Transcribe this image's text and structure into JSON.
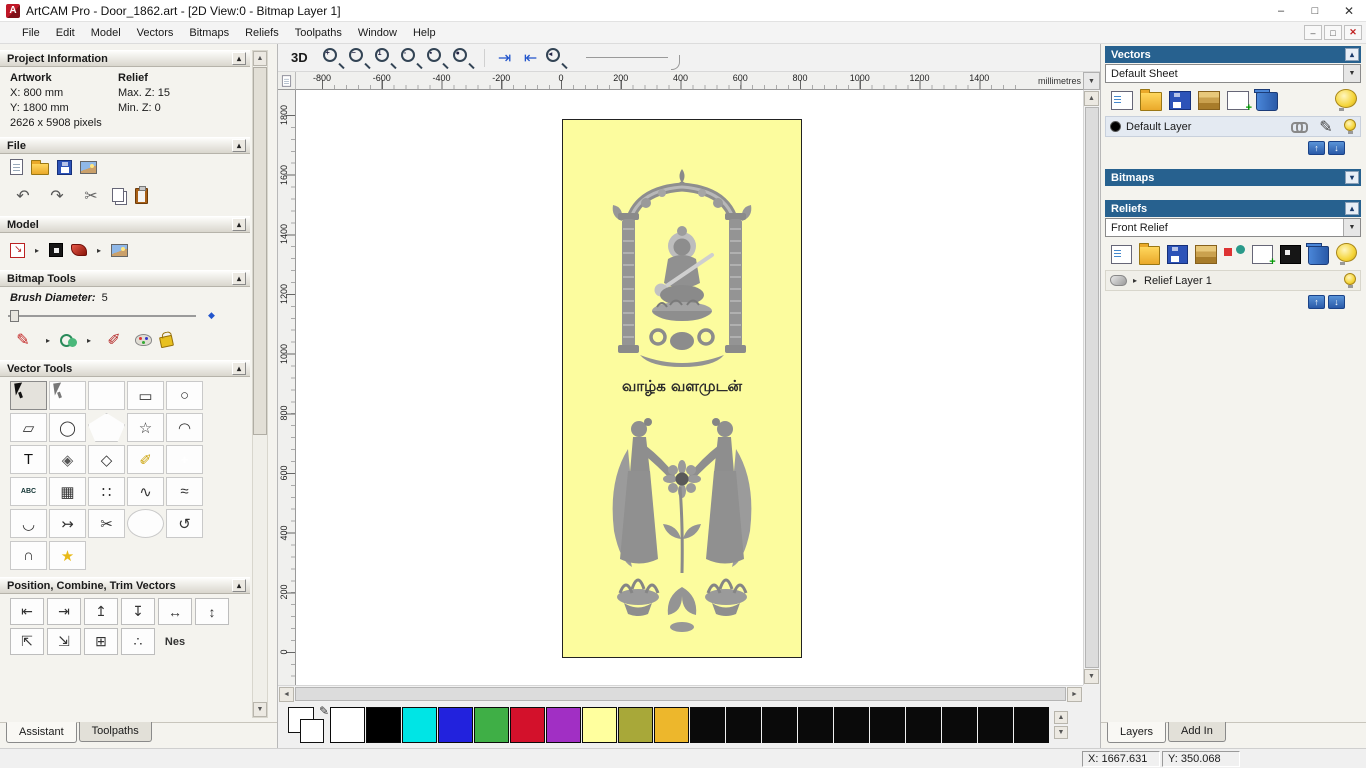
{
  "window": {
    "title": "ArtCAM Pro - Door_1862.art - [2D View:0 - Bitmap Layer 1]",
    "controls": [
      {
        "name": "minimize-button",
        "glyph": "–"
      },
      {
        "name": "maximize-button",
        "glyph": "□"
      },
      {
        "name": "close-button",
        "glyph": "✕"
      }
    ],
    "child_controls": [
      {
        "name": "child-minimize-button",
        "glyph": "–"
      },
      {
        "name": "child-restore-button",
        "glyph": "□"
      },
      {
        "name": "child-close-button",
        "glyph": "✕"
      }
    ]
  },
  "menubar": {
    "items": [
      "File",
      "Edit",
      "Model",
      "Vectors",
      "Bitmaps",
      "Reliefs",
      "Toolpaths",
      "Window",
      "Help"
    ]
  },
  "left_panel": {
    "project_information": {
      "header": "Project Information",
      "artwork_label": "Artwork",
      "relief_label": "Relief",
      "rows": [
        [
          "X: 800 mm",
          "Max. Z: 15"
        ],
        [
          "Y: 1800 mm",
          "Min. Z: 0"
        ]
      ],
      "pixels": "2626 x 5908 pixels"
    },
    "file_section": {
      "header": "File",
      "icons_row1": [
        {
          "name": "new-model-icon",
          "shape": "page"
        },
        {
          "name": "open-model-icon",
          "shape": "folder"
        },
        {
          "name": "save-model-icon",
          "shape": "disk"
        },
        {
          "name": "export-image-icon",
          "shape": "picture"
        }
      ],
      "icons_row2": [
        {
          "name": "undo-icon",
          "glyph": "↶",
          "color": "#555555"
        },
        {
          "name": "redo-icon",
          "glyph": "↷",
          "color": "#555555"
        },
        {
          "name": "cut-icon",
          "glyph": "✂",
          "color": "#666666"
        },
        {
          "name": "copy-icon",
          "shape": "copy"
        },
        {
          "name": "paste-icon",
          "shape": "clipboard"
        }
      ]
    },
    "model_section": {
      "header": "Model",
      "icons": [
        {
          "name": "set-model-size-icon",
          "shape": "modelsize"
        },
        {
          "name": "model-flyout-icon",
          "glyph": "▸",
          "color": "#333333",
          "cls": "tiny"
        },
        {
          "name": "invert-model-icon",
          "shape": "invert"
        },
        {
          "name": "relief-from-image-icon",
          "shape": "red3d"
        },
        {
          "name": "model-flyout2-icon",
          "glyph": "▸",
          "color": "#333333",
          "cls": "tiny"
        },
        {
          "name": "lighting-icon",
          "shape": "picture"
        }
      ]
    },
    "bitmap_tools": {
      "header": "Bitmap Tools",
      "brush_diameter_label": "Brush Diameter:",
      "brush_diameter_value": "5",
      "slider_diamond": {
        "name": "slider-diamond-icon",
        "glyph": "◆",
        "color": "#2255cc"
      },
      "icons": [
        {
          "name": "paint-brush-icon",
          "glyph": "✎",
          "color": "#c22222"
        },
        {
          "name": "paint-flyout-icon",
          "glyph": "▸",
          "color": "#333333",
          "cls": "tiny"
        },
        {
          "name": "flood-fill-icon",
          "shape": "floodfill"
        },
        {
          "name": "flood-flyout-icon",
          "glyph": "▸",
          "color": "#333333",
          "cls": "tiny"
        },
        {
          "name": "spray-icon",
          "glyph": "✐",
          "color": "#b22222"
        },
        {
          "name": "palette-icon",
          "shape": "palette"
        },
        {
          "name": "colour-eraser-icon",
          "shape": "bucket"
        }
      ]
    },
    "vector_tools": {
      "header": "Vector Tools",
      "icons": [
        {
          "name": "select-vectors-icon",
          "shape": "cursor",
          "cls": "pressed"
        },
        {
          "name": "node-editing-icon",
          "shape": "cursor2"
        },
        {
          "name": "transform-vectors-icon",
          "shape": "move"
        },
        {
          "name": "create-rectangle-icon",
          "glyph": "▭"
        },
        {
          "name": "create-circle-icon",
          "glyph": "○"
        },
        {
          "name": "create-freehand-icon",
          "glyph": "▱"
        },
        {
          "name": "create-ellipse-icon",
          "glyph": "◯"
        },
        {
          "name": "create-polygon-icon",
          "shape": "pentagon"
        },
        {
          "name": "create-star-icon",
          "glyph": "☆"
        },
        {
          "name": "create-arc-icon",
          "glyph": "◠"
        },
        {
          "name": "create-text-icon",
          "glyph": "T",
          "color": "#111111"
        },
        {
          "name": "mirror-vectors-icon",
          "glyph": "◈",
          "color": "#555555"
        },
        {
          "name": "offset-vectors-icon",
          "glyph": "◇"
        },
        {
          "name": "measure-icon",
          "glyph": "✐",
          "color": "#caa000"
        },
        {
          "name": "block-paste-icon",
          "shape": "greencross",
          "text": "+"
        },
        {
          "name": "paste-text-icon",
          "shape": "abc",
          "text": "ABC"
        },
        {
          "name": "paste-along-curve-icon",
          "glyph": "▦"
        },
        {
          "name": "block-copy-icon",
          "glyph": "∷"
        },
        {
          "name": "fit-curve-icon",
          "glyph": "∿"
        },
        {
          "name": "fit-arcs-icon",
          "glyph": "≈"
        },
        {
          "name": "fillet-icon",
          "glyph": "◡"
        },
        {
          "name": "join-vectors-icon",
          "glyph": "↣"
        },
        {
          "name": "trim-vectors-icon",
          "glyph": "✂",
          "color": "#333333"
        },
        {
          "name": "sphere-tool-icon",
          "shape": "sphere"
        },
        {
          "name": "bend-vectors-icon",
          "glyph": "↺"
        },
        {
          "name": "section-profile-icon",
          "glyph": "∩"
        },
        {
          "name": "wand-star-icon",
          "glyph": "★",
          "color": "#e8b916"
        }
      ]
    },
    "position_section": {
      "header": "Position, Combine, Trim Vectors",
      "icons_row1": [
        {
          "name": "align-left-icon",
          "glyph": "⇤"
        },
        {
          "name": "align-right-icon",
          "glyph": "⇥"
        },
        {
          "name": "align-top-icon",
          "glyph": "↥"
        },
        {
          "name": "align-bottom-icon",
          "glyph": "↧"
        },
        {
          "name": "center-horizontal-icon",
          "glyph": "↔"
        },
        {
          "name": "center-vertical-icon",
          "glyph": "↕"
        }
      ],
      "icons_row2": [
        {
          "name": "snap-corner-left-icon",
          "glyph": "⇱"
        },
        {
          "name": "snap-corner-right-icon",
          "glyph": "⇲"
        },
        {
          "name": "paste-array-icon",
          "glyph": "⊞"
        },
        {
          "name": "scatter-copies-icon",
          "glyph": "∴"
        },
        {
          "name": "nesting-icon",
          "text": "Nes",
          "cls": "nes"
        }
      ]
    },
    "tabs": [
      {
        "label": "Assistant",
        "active": true
      },
      {
        "label": "Toolpaths",
        "active": false
      }
    ]
  },
  "toolbar": {
    "view_3d_label": "3D",
    "zoom_icons": [
      {
        "name": "zoom-in-icon",
        "shape": "zoom",
        "text": "+"
      },
      {
        "name": "zoom-out-icon",
        "shape": "zoom",
        "text": "−"
      },
      {
        "name": "zoom-1to1-icon",
        "shape": "zoom",
        "text": "1"
      },
      {
        "name": "zoom-fit-page-icon",
        "shape": "zoom",
        "text": "▫"
      },
      {
        "name": "zoom-fit-drawing-icon",
        "shape": "zoom",
        "text": "▪"
      },
      {
        "name": "zoom-objects-icon",
        "shape": "zoom",
        "text": "●"
      }
    ],
    "layer_nav_icons": [
      {
        "name": "previous-bitmap-layer-icon",
        "glyph": "⇥",
        "color": "#2255cc"
      },
      {
        "name": "next-bitmap-layer-icon",
        "glyph": "⇤",
        "color": "#2255cc"
      },
      {
        "name": "zoom-previous-view-icon",
        "shape": "zoom",
        "text": "◂"
      }
    ]
  },
  "rulers": {
    "horizontal_ticks": [
      "-800",
      "-600",
      "-400",
      "-200",
      "0",
      "200",
      "400",
      "600",
      "800",
      "1000",
      "1200",
      "1400"
    ],
    "vertical_ticks": [
      "1800",
      "1600",
      "1400",
      "1200",
      "1000",
      "800",
      "600",
      "400",
      "200",
      "0"
    ],
    "units_label": "millimetres"
  },
  "canvas": {
    "artwork_text": "வாழ்க வளமுடன்",
    "background_color": "#FCFC9E"
  },
  "right_panel": {
    "vectors": {
      "header": "Vectors",
      "sheet_value": "Default Sheet",
      "icons": [
        {
          "name": "new-vector-sheet-icon",
          "shape": "pageblue"
        },
        {
          "name": "open-vectors-icon",
          "shape": "folder"
        },
        {
          "name": "save-vectors-icon",
          "shape": "disk"
        },
        {
          "name": "import-vectors-icon",
          "shape": "stack"
        },
        {
          "name": "new-vector-layer-icon",
          "shape": "pageplus"
        },
        {
          "name": "delete-vector-layer-icon",
          "shape": "trash"
        },
        {
          "name": "toggle-all-vectors-visibility-icon",
          "shape": "bulb",
          "cls": "push-right"
        }
      ],
      "layer": {
        "name": "Default Layer",
        "color": "#000000"
      },
      "layer_icons": [
        {
          "name": "snap-layer-icon",
          "shape": "link"
        },
        {
          "name": "edit-layer-icon",
          "glyph": "✎",
          "color": "#444444"
        },
        {
          "name": "layer-visibility-icon",
          "shape": "bulb"
        }
      ]
    },
    "bitmaps": {
      "header": "Bitmaps"
    },
    "reliefs": {
      "header": "Reliefs",
      "relief_value": "Front Relief",
      "icons": [
        {
          "name": "new-relief-icon",
          "shape": "pageblue"
        },
        {
          "name": "open-relief-icon",
          "shape": "folder"
        },
        {
          "name": "save-relief-icon",
          "shape": "disk"
        },
        {
          "name": "import-relief-icon",
          "shape": "stack"
        },
        {
          "name": "relief-shapes-icon",
          "shape": "shapes"
        },
        {
          "name": "new-relief-layer-icon",
          "shape": "pageplus"
        },
        {
          "name": "save-relief-layer-icon",
          "shape": "invert"
        },
        {
          "name": "delete-relief-layer-icon",
          "shape": "trash"
        },
        {
          "name": "toggle-relief-visibility-icon",
          "shape": "bulb",
          "cls": "push-right"
        }
      ],
      "layer": {
        "name": "Relief Layer 1"
      },
      "layer_left_icons": [
        {
          "name": "relief-thumbnail-icon",
          "shape": "thumb"
        },
        {
          "name": "expand-relief-layer-icon",
          "glyph": "▸",
          "color": "#333333",
          "cls": "tiny"
        }
      ],
      "layer_right_icons": [
        {
          "name": "relief-layer-visibility-icon",
          "shape": "bulb"
        }
      ]
    },
    "tabs": [
      {
        "label": "Layers",
        "active": true
      },
      {
        "label": "Add In",
        "active": false
      }
    ]
  },
  "color_palette": {
    "swatches": [
      "#ffffff",
      "#000000",
      "#00e5e5",
      "#2222dd",
      "#3faf46",
      "#d3112b",
      "#a12fc4",
      "#ffff9e",
      "#a8a839",
      "#edb72c",
      "#0a0a0a",
      "#0a0a0a",
      "#0a0a0a",
      "#0a0a0a",
      "#0a0a0a",
      "#0a0a0a",
      "#0a0a0a",
      "#0a0a0a",
      "#0a0a0a",
      "#0a0a0a"
    ]
  },
  "statusbar": {
    "x": "X: 1667.631",
    "y": "Y: 350.068"
  }
}
